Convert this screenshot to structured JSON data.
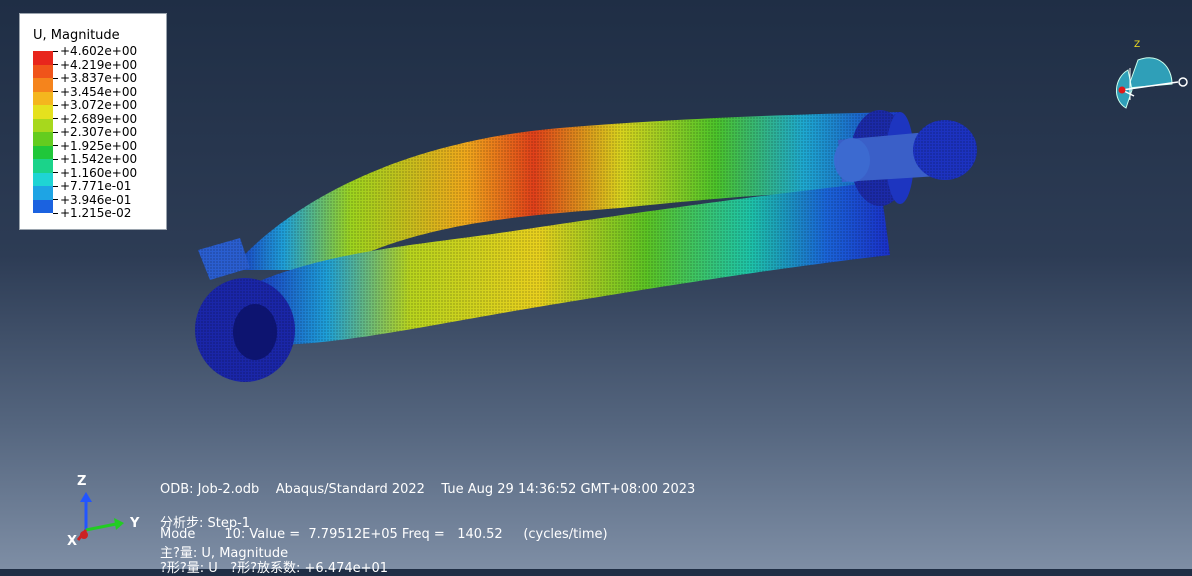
{
  "legend": {
    "title": "U, Magnitude",
    "levels": [
      {
        "label": "+4.602e+00",
        "color": "#e8261c"
      },
      {
        "label": "+4.219e+00",
        "color": "#f0541a"
      },
      {
        "label": "+3.837e+00",
        "color": "#f5841c"
      },
      {
        "label": "+3.454e+00",
        "color": "#f4b61e"
      },
      {
        "label": "+3.072e+00",
        "color": "#e5e11e"
      },
      {
        "label": "+2.689e+00",
        "color": "#a7d81d"
      },
      {
        "label": "+2.307e+00",
        "color": "#64cc1f"
      },
      {
        "label": "+1.925e+00",
        "color": "#20c73a"
      },
      {
        "label": "+1.542e+00",
        "color": "#1bd38a"
      },
      {
        "label": "+1.160e+00",
        "color": "#1fd4d4"
      },
      {
        "label": "+7.771e-01",
        "color": "#1ea4e4"
      },
      {
        "label": "+3.946e-01",
        "color": "#1b62e0"
      },
      {
        "label": "+1.215e-02",
        "color": "#1a25c8"
      }
    ]
  },
  "info": {
    "line1": "ODB: Job-2.odb    Abaqus/Standard 2022    Tue Aug 29 14:36:52 GMT+08:00 2023",
    "line2": "分析步: Step-1",
    "line3": "Mode       10: Value =  7.79512E+05 Freq =   140.52     (cycles/time)",
    "line4": "主?量: U, Magnitude",
    "line5": "?形?量: U   ?形?放系数: +6.474e+01"
  },
  "triad": {
    "z": "Z",
    "y": "Y",
    "x": "X"
  },
  "view_cube": {
    "z": "Z"
  }
}
